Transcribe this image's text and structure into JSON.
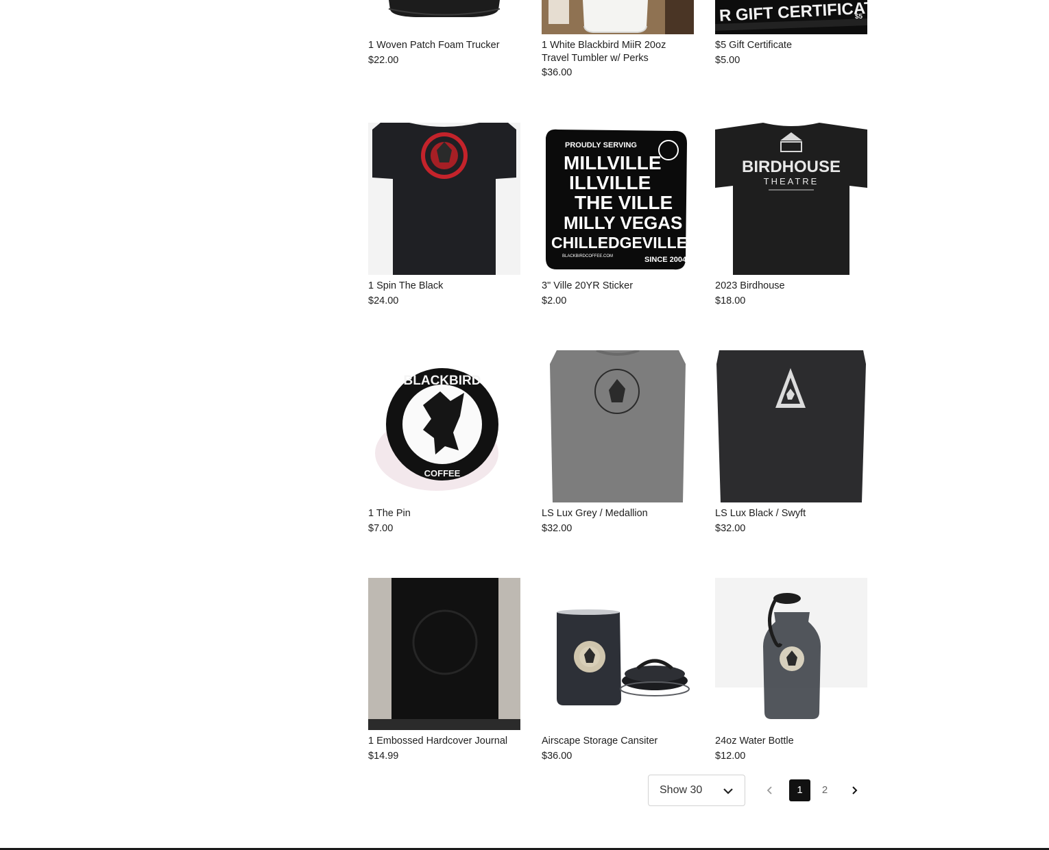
{
  "products": [
    {
      "title": "1 Woven Patch Foam Trucker",
      "price": "$22.00"
    },
    {
      "title": "1 White Blackbird MiiR 20oz Travel Tumbler w/ Perks",
      "price": "$36.00"
    },
    {
      "title": "$5 Gift Certificate",
      "price": "$5.00"
    },
    {
      "title": "1 Spin The Black",
      "price": "$24.00"
    },
    {
      "title": "3\" Ville 20YR Sticker",
      "price": "$2.00"
    },
    {
      "title": "2023 Birdhouse",
      "price": "$18.00"
    },
    {
      "title": "1 The Pin",
      "price": "$7.00"
    },
    {
      "title": "LS Lux Grey / Medallion",
      "price": "$32.00"
    },
    {
      "title": "LS Lux Black / Swyft",
      "price": "$32.00"
    },
    {
      "title": "1 Embossed Hardcover Journal",
      "price": "$14.99"
    },
    {
      "title": "Airscape Storage Cansiter",
      "price": "$36.00"
    },
    {
      "title": "24oz Water Bottle",
      "price": "$12.00"
    }
  ],
  "image_text": {
    "gift_banner": "R GIFT CERTIFICATE",
    "gift_value": "$5",
    "sticker_header": "PROUDLY SERVING",
    "sticker_lines": [
      "MILLVILLE",
      "ILLVILLE",
      "THE VILLE",
      "MILLY VEGAS",
      "CHILLEDGEVILLE"
    ],
    "sticker_footer_left": "BLACKBIRDCOFFEE.COM",
    "sticker_footer_right": "SINCE 2004",
    "birdhouse_line1": "BIRDHOUSE",
    "birdhouse_line2": "THEATRE",
    "pin_top": "BLACKBIRD",
    "pin_bottom": "COFFEE"
  },
  "pagination": {
    "show_label": "Show 30",
    "pages": [
      "1",
      "2"
    ],
    "current_page": "1"
  },
  "colors": {
    "text": "#1e1e1e",
    "active_page_bg": "#111111",
    "border": "#d2d2d2"
  }
}
